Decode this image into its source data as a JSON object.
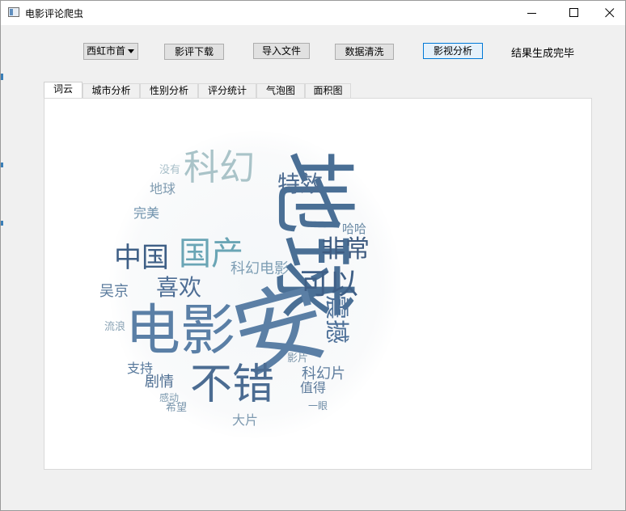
{
  "window": {
    "title": "电影评论爬虫"
  },
  "toolbar": {
    "combo_value": "西虹市首",
    "download_label": "影评下载",
    "import_label": "导入文件",
    "clean_label": "数据清洗",
    "analyze_label": "影视分析",
    "status_text": "结果生成完毕"
  },
  "tabs": [
    "词云",
    "城市分析",
    "性别分析",
    "评分统计",
    "气泡图",
    "面积图"
  ],
  "wordcloud": {
    "words": [
      {
        "text": "地球",
        "color": "#4a6f95",
        "rot": 90
      },
      {
        "text": "安",
        "color": "#5b7fa5",
        "rot": -20
      },
      {
        "text": "电影",
        "color": "#5a7fa6",
        "rot": 0
      },
      {
        "text": "不错",
        "color": "#4b6c92",
        "rot": 0
      },
      {
        "text": "科幻",
        "color": "#a9c3c8",
        "rot": 0
      },
      {
        "text": "中国",
        "color": "#3e5f86",
        "rot": 0
      },
      {
        "text": "国产",
        "color": "#6aa5b5",
        "rot": 0
      },
      {
        "text": "喜欢",
        "color": "#4e6e95",
        "rot": 0
      },
      {
        "text": "特效",
        "color": "#4e6d92",
        "rot": 0
      },
      {
        "text": "非常",
        "color": "#3e5b80",
        "rot": 0
      },
      {
        "text": "可以",
        "color": "#3f5f86",
        "rot": 0
      },
      {
        "text": "震撼",
        "color": "#4d7098",
        "rot": 90
      },
      {
        "text": "科幻电影",
        "color": "#7f9fb5",
        "rot": 0
      },
      {
        "text": "吴京",
        "color": "#5c7c9e",
        "rot": 0
      },
      {
        "text": "完美",
        "color": "#6f92ac",
        "rot": 0
      },
      {
        "text": "剧情",
        "color": "#4e6e92",
        "rot": 0
      },
      {
        "text": "支持",
        "color": "#58799c",
        "rot": 0
      },
      {
        "text": "科幻片",
        "color": "#5e7d9e",
        "rot": 0
      },
      {
        "text": "值得",
        "color": "#5c7a9b",
        "rot": 0
      },
      {
        "text": "影片",
        "color": "#7b95aa",
        "rot": 0
      },
      {
        "text": "哈哈",
        "color": "#6a8aa5",
        "rot": 0
      },
      {
        "text": "地球",
        "color": "#7f9bb0",
        "rot": 0
      },
      {
        "text": "没有",
        "color": "#a8bfc9",
        "rot": 0
      },
      {
        "text": "流浪",
        "color": "#8aa3b5",
        "rot": 0
      },
      {
        "text": "大片",
        "color": "#7e9ab0",
        "rot": 0
      },
      {
        "text": "希望",
        "color": "#7b97ad",
        "rot": 0
      },
      {
        "text": "感动",
        "color": "#7d9aaf",
        "rot": 0
      },
      {
        "text": "一眼",
        "color": "#6e8ca6",
        "rot": 0
      }
    ]
  }
}
